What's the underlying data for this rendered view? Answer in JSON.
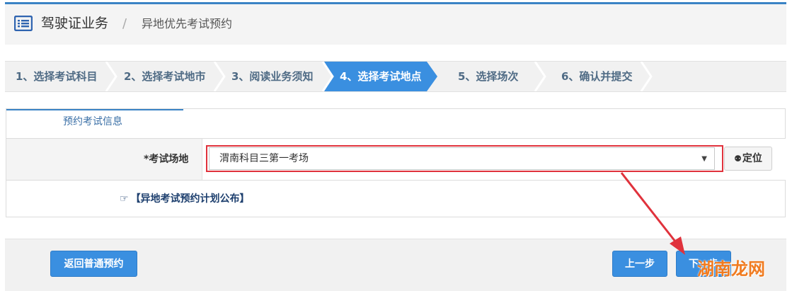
{
  "header": {
    "title": "驾驶证业务",
    "separator": "/",
    "subtitle": "异地优先考试预约"
  },
  "steps": [
    {
      "label": "1、选择考试科目",
      "active": false
    },
    {
      "label": "2、选择考试地市",
      "active": false
    },
    {
      "label": "3、阅读业务须知",
      "active": false
    },
    {
      "label": "4、选择考试地点",
      "active": true
    },
    {
      "label": "5、选择场次",
      "active": false
    },
    {
      "label": "6、确认并提交",
      "active": false
    }
  ],
  "panel": {
    "tab_label": "预约考试信息",
    "field_label": "*考试场地",
    "select_value": "渭南科目三第一考场",
    "locate_label": "定位",
    "plan_link": "【异地考试预约计划公布】"
  },
  "footer": {
    "back_label": "返回普通预约",
    "prev_label": "上一步",
    "next_label": "下一步"
  },
  "watermark": "湖南龙网",
  "colors": {
    "accent": "#3a83c5",
    "active_step": "#3a8fe0",
    "highlight": "#e0323c",
    "watermark": "#f07b20"
  }
}
